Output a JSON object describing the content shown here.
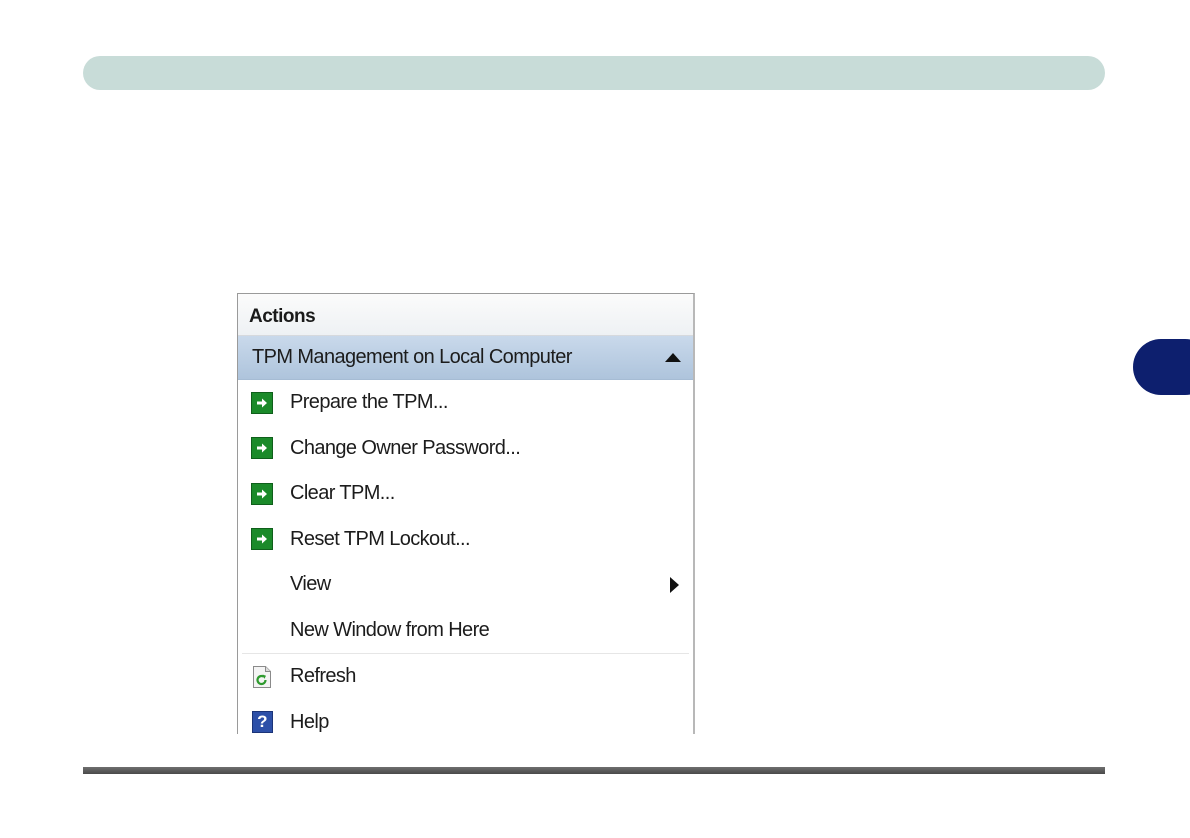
{
  "panel": {
    "title": "Actions",
    "section": {
      "label": "TPM Management on Local Computer",
      "collapse_icon": "triangle-up-icon"
    },
    "items": [
      {
        "label": "Prepare the TPM...",
        "icon": "green-arrow-icon"
      },
      {
        "label": "Change Owner Password...",
        "icon": "green-arrow-icon"
      },
      {
        "label": "Clear TPM...",
        "icon": "green-arrow-icon"
      },
      {
        "label": "Reset TPM Lockout...",
        "icon": "green-arrow-icon"
      },
      {
        "label": "View",
        "icon": "",
        "submenu_icon": "triangle-right-icon"
      },
      {
        "label": "New Window from Here",
        "icon": ""
      },
      {
        "label": "Refresh",
        "icon": "refresh-icon"
      },
      {
        "label": "Help",
        "icon": "help-icon"
      }
    ]
  },
  "colors": {
    "header_band": "#c8dcd8",
    "side_tab": "#0d1f6e",
    "section_highlight": "#b7cce2",
    "action_icon_green": "#1b8a2a"
  }
}
